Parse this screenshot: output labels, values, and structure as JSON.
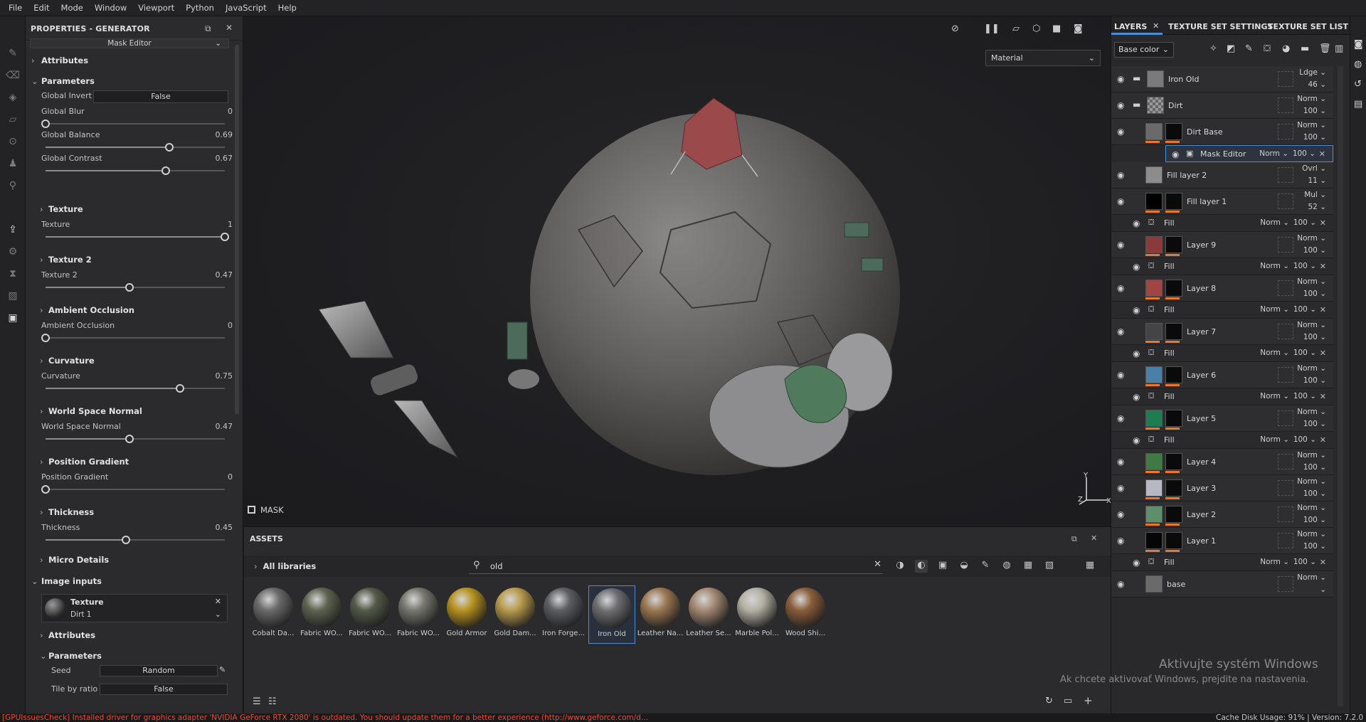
{
  "menu": [
    "File",
    "Edit",
    "Mode",
    "Window",
    "Viewport",
    "Python",
    "JavaScript",
    "Help"
  ],
  "properties": {
    "title": "PROPERTIES - GENERATOR",
    "subtitle": "Mask Editor",
    "sections": {
      "attributes": "Attributes",
      "parameters": "Parameters",
      "image_inputs": "Image inputs",
      "attributes2": "Attributes",
      "parameters2": "Parameters"
    },
    "global_invert": {
      "label": "Global Invert",
      "value": "False"
    },
    "sliders": [
      {
        "label": "Global Blur",
        "value": "0",
        "fraction": 0.0
      },
      {
        "label": "Global Balance",
        "value": "0.69",
        "fraction": 0.69
      },
      {
        "label": "Global Contrast",
        "value": "0.67",
        "fraction": 0.67
      }
    ],
    "groups": [
      {
        "title": "Texture",
        "label": "Texture",
        "value": "1",
        "fraction": 1.0
      },
      {
        "title": "Texture 2",
        "label": "Texture 2",
        "value": "0.47",
        "fraction": 0.47
      },
      {
        "title": "Ambient Occlusion",
        "label": "Ambient Occlusion",
        "value": "0",
        "fraction": 0.0
      },
      {
        "title": "Curvature",
        "label": "Curvature",
        "value": "0.75",
        "fraction": 0.75
      },
      {
        "title": "World Space Normal",
        "label": "World Space Normal",
        "value": "0.47",
        "fraction": 0.47
      },
      {
        "title": "Position Gradient",
        "label": "Position Gradient",
        "value": "0",
        "fraction": 0.0
      },
      {
        "title": "Thickness",
        "label": "Thickness",
        "value": "0.45",
        "fraction": 0.45
      }
    ],
    "micro_details": "Micro Details",
    "image_input": {
      "title": "Texture",
      "value": "Dirt 1"
    },
    "seed": {
      "label": "Seed",
      "value": "Random"
    },
    "tile_by_ratio": {
      "label": "Tile by ratio",
      "value": "False"
    }
  },
  "viewport": {
    "material_select": "Material",
    "mask_label": "MASK",
    "axis_y": "Y",
    "axis_z": "Z",
    "axis_x": "X"
  },
  "assets": {
    "title": "ASSETS",
    "all_libraries": "All libraries",
    "search_value": "old",
    "items": [
      {
        "name": "Cobalt Da...",
        "color": "#6a6a6a"
      },
      {
        "name": "Fabric WO...",
        "color": "#5d6451"
      },
      {
        "name": "Fabric WO...",
        "color": "#525a48"
      },
      {
        "name": "Fabric WO...",
        "color": "#77776f"
      },
      {
        "name": "Gold Armor",
        "color": "#b89320"
      },
      {
        "name": "Gold Dam...",
        "color": "#b99b4c"
      },
      {
        "name": "Iron Forge...",
        "color": "#5c5e62"
      },
      {
        "name": "Iron Old",
        "color": "#6e6e70"
      },
      {
        "name": "Leather Na...",
        "color": "#9b7852"
      },
      {
        "name": "Leather Se...",
        "color": "#a58a74"
      },
      {
        "name": "Marble Pol...",
        "color": "#b4b0a4"
      },
      {
        "name": "Wood Shi...",
        "color": "#8a5e3a"
      }
    ]
  },
  "layers_panel": {
    "tabs": [
      "LAYERS",
      "TEXTURE SET SETTINGS",
      "TEXTURE SET LIST"
    ],
    "channel": "Base color",
    "rows": [
      {
        "kind": "main",
        "name": "Iron Old",
        "blend": "Ldge",
        "opacity": "46",
        "thumb": "#7a7a7a",
        "folder": true
      },
      {
        "kind": "main",
        "name": "Dirt",
        "blend": "Norm",
        "opacity": "100",
        "thumb": "#8a8a8a",
        "folder": true,
        "checker": true
      },
      {
        "kind": "main",
        "name": "Dirt Base",
        "blend": "Norm",
        "opacity": "100",
        "thumb": "#6a6a6a",
        "mask": true
      },
      {
        "kind": "child",
        "name": "Mask Editor",
        "blend": "Norm",
        "opacity": "100",
        "selected": true
      },
      {
        "kind": "main",
        "name": "Fill layer 2",
        "blend": "Ovrl",
        "opacity": "11",
        "thumb": "#8c8c8c"
      },
      {
        "kind": "main",
        "name": "Fill layer 1",
        "blend": "Mul",
        "opacity": "52",
        "thumb": "#000000",
        "mask": true
      },
      {
        "kind": "child",
        "name": "Fill",
        "blend": "Norm",
        "opacity": "100"
      },
      {
        "kind": "main",
        "name": "Layer 9",
        "blend": "Norm",
        "opacity": "100",
        "thumb": "#8a3a3a",
        "mask": true
      },
      {
        "kind": "child",
        "name": "Fill",
        "blend": "Norm",
        "opacity": "100"
      },
      {
        "kind": "main",
        "name": "Layer 8",
        "blend": "Norm",
        "opacity": "100",
        "thumb": "#a04444",
        "mask": true
      },
      {
        "kind": "child",
        "name": "Fill",
        "blend": "Norm",
        "opacity": "100"
      },
      {
        "kind": "main",
        "name": "Layer 7",
        "blend": "Norm",
        "opacity": "100",
        "thumb": "#444446",
        "mask": true
      },
      {
        "kind": "child",
        "name": "Fill",
        "blend": "Norm",
        "opacity": "100"
      },
      {
        "kind": "main",
        "name": "Layer 6",
        "blend": "Norm",
        "opacity": "100",
        "thumb": "#4a7fa8",
        "mask": true
      },
      {
        "kind": "child",
        "name": "Fill",
        "blend": "Norm",
        "opacity": "100"
      },
      {
        "kind": "main",
        "name": "Layer 5",
        "blend": "Norm",
        "opacity": "100",
        "thumb": "#1d7c52",
        "mask": true
      },
      {
        "kind": "child",
        "name": "Fill",
        "blend": "Norm",
        "opacity": "100"
      },
      {
        "kind": "main",
        "name": "Layer 4",
        "blend": "Norm",
        "opacity": "100",
        "thumb": "#3f7a44",
        "mask": true
      },
      {
        "kind": "main",
        "name": "Layer 3",
        "blend": "Norm",
        "opacity": "100",
        "thumb": "#b8b8c2",
        "mask": true
      },
      {
        "kind": "main",
        "name": "Layer 2",
        "blend": "Norm",
        "opacity": "100",
        "thumb": "#5f8f6a",
        "mask": true
      },
      {
        "kind": "main",
        "name": "Layer 1",
        "blend": "Norm",
        "opacity": "100",
        "thumb": "#050505",
        "mask": true
      },
      {
        "kind": "child",
        "name": "Fill",
        "blend": "Norm",
        "opacity": "100"
      },
      {
        "kind": "main",
        "name": "base",
        "blend": "Norm",
        "opacity": "",
        "thumb": "#6a6a6a"
      }
    ]
  },
  "watermark": {
    "line1": "Aktivujte systém Windows",
    "line2": "Ak chcete aktivovať Windows, prejdite na nastavenia."
  },
  "status": {
    "message": "[GPUIssuesCheck] Installed driver for graphics adapter 'NVIDIA GeForce RTX 2080' is outdated. You should update them for a better experience (http://www.geforce.com/d...",
    "cache": "Cache Disk Usage:   91%  |  Version: 7.2.0"
  }
}
